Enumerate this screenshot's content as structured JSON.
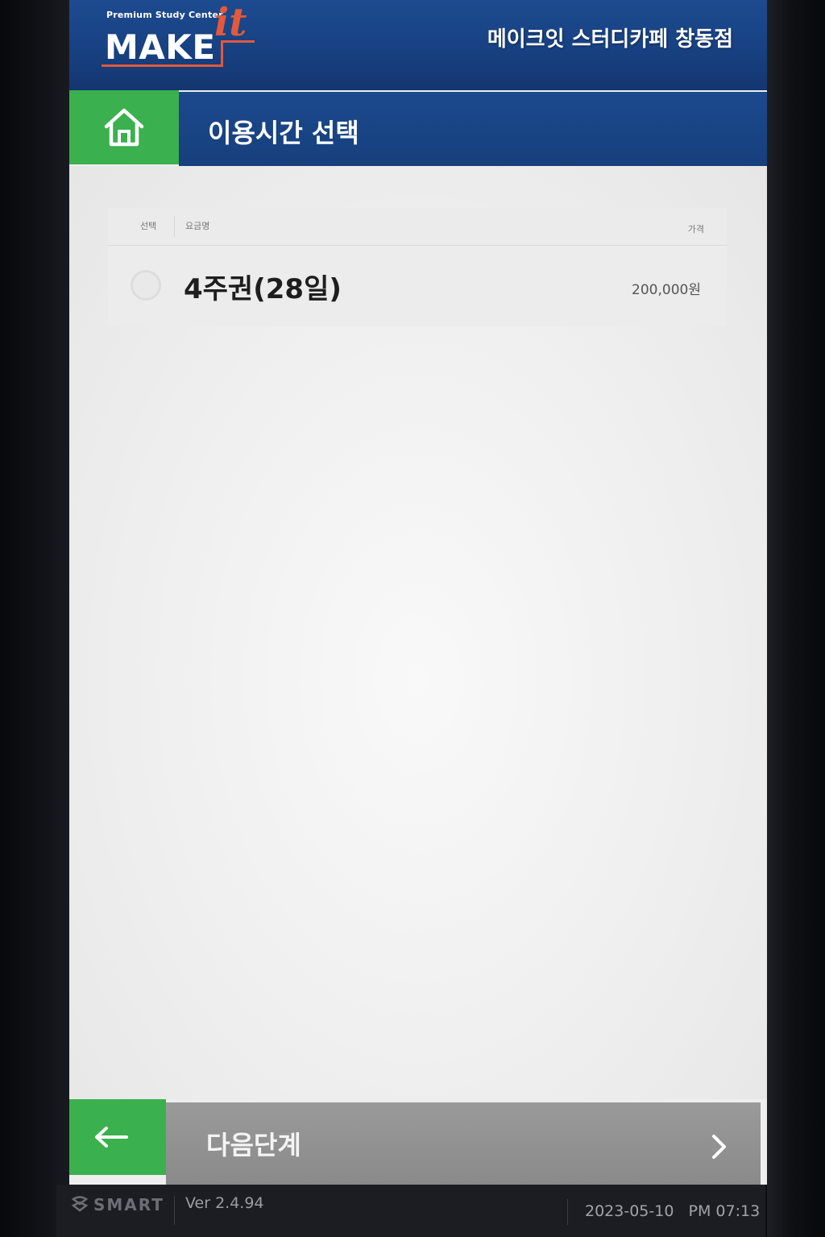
{
  "header": {
    "logo_tagline": "Premium Study Center",
    "logo_main": "MAKE",
    "logo_it": "it",
    "store_name": "메이크잇 스터디카페 창동점"
  },
  "title_bar": {
    "title": "이용시간 선택"
  },
  "table": {
    "columns": {
      "select": "선택",
      "name": "요금명",
      "price": "가격"
    },
    "rows": [
      {
        "name": "4주권(28일)",
        "price": "200,000원",
        "selected": false
      }
    ]
  },
  "nav": {
    "next_label": "다음단계"
  },
  "footer": {
    "brand": "SMART",
    "version": "Ver 2.4.94",
    "date": "2023-05-10",
    "time": "PM 07:13"
  },
  "colors": {
    "header_blue": "#1a4589",
    "accent_green": "#3bb04e",
    "next_gray": "#929292",
    "logo_orange": "#e2593b"
  },
  "icons": {
    "home": "home-icon",
    "back": "arrow-left-icon",
    "next": "chevron-right-icon",
    "brand": "smart-logo-icon"
  }
}
